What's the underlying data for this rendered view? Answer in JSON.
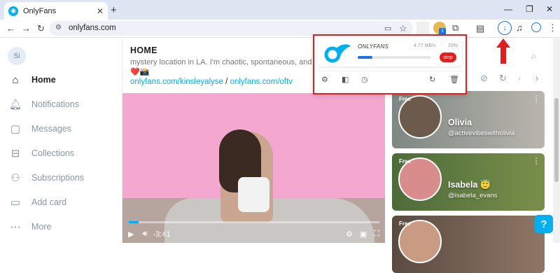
{
  "browser": {
    "tab_title": "OnlyFans",
    "tab_favicon": "onlyfans-favicon",
    "url": "onlyfans.com",
    "download_badge": "1"
  },
  "sidebar": {
    "avatar_initials": "Si",
    "items": [
      {
        "label": "Home",
        "icon": "home-icon",
        "active": true
      },
      {
        "label": "Notifications",
        "icon": "bell-icon",
        "active": false
      },
      {
        "label": "Messages",
        "icon": "chat-icon",
        "active": false
      },
      {
        "label": "Collections",
        "icon": "bookmark-icon",
        "active": false
      },
      {
        "label": "Subscriptions",
        "icon": "users-icon",
        "active": false
      },
      {
        "label": "Add card",
        "icon": "card-icon",
        "active": false
      },
      {
        "label": "More",
        "icon": "more-icon",
        "active": false
      }
    ]
  },
  "main": {
    "title": "HOME",
    "bio_partial": "mystery location in LA. I'm chaotic, spontaneous, and honest",
    "emoji": "❤️📸",
    "links": [
      "onlyfans.com/kinsleyalyse",
      "onlyfans.com/oftv"
    ],
    "link_separator": "/",
    "video": {
      "time": "-3:41",
      "progress_fraction": 0.04
    }
  },
  "download_popup": {
    "name": "ONLYFANS",
    "speed": "4.77 MB/s",
    "percent": "20%",
    "progress_fraction": 0.2,
    "stop_label": "stop"
  },
  "suggestions": [
    {
      "badge": "Free",
      "name": "Olivia",
      "handle": "@activevibeswitholivia",
      "bg": "#8a8f88"
    },
    {
      "badge": "Free",
      "name": "Isabela 😇",
      "handle": "@isabela_evans",
      "bg": "#4d6b3a"
    },
    {
      "badge": "Free",
      "name": "",
      "handle": "",
      "bg": "#6b5a4e"
    }
  ],
  "colors": {
    "accent": "#00aff0",
    "highlight_border": "#e0201f",
    "download_blue": "#1a73e8"
  }
}
